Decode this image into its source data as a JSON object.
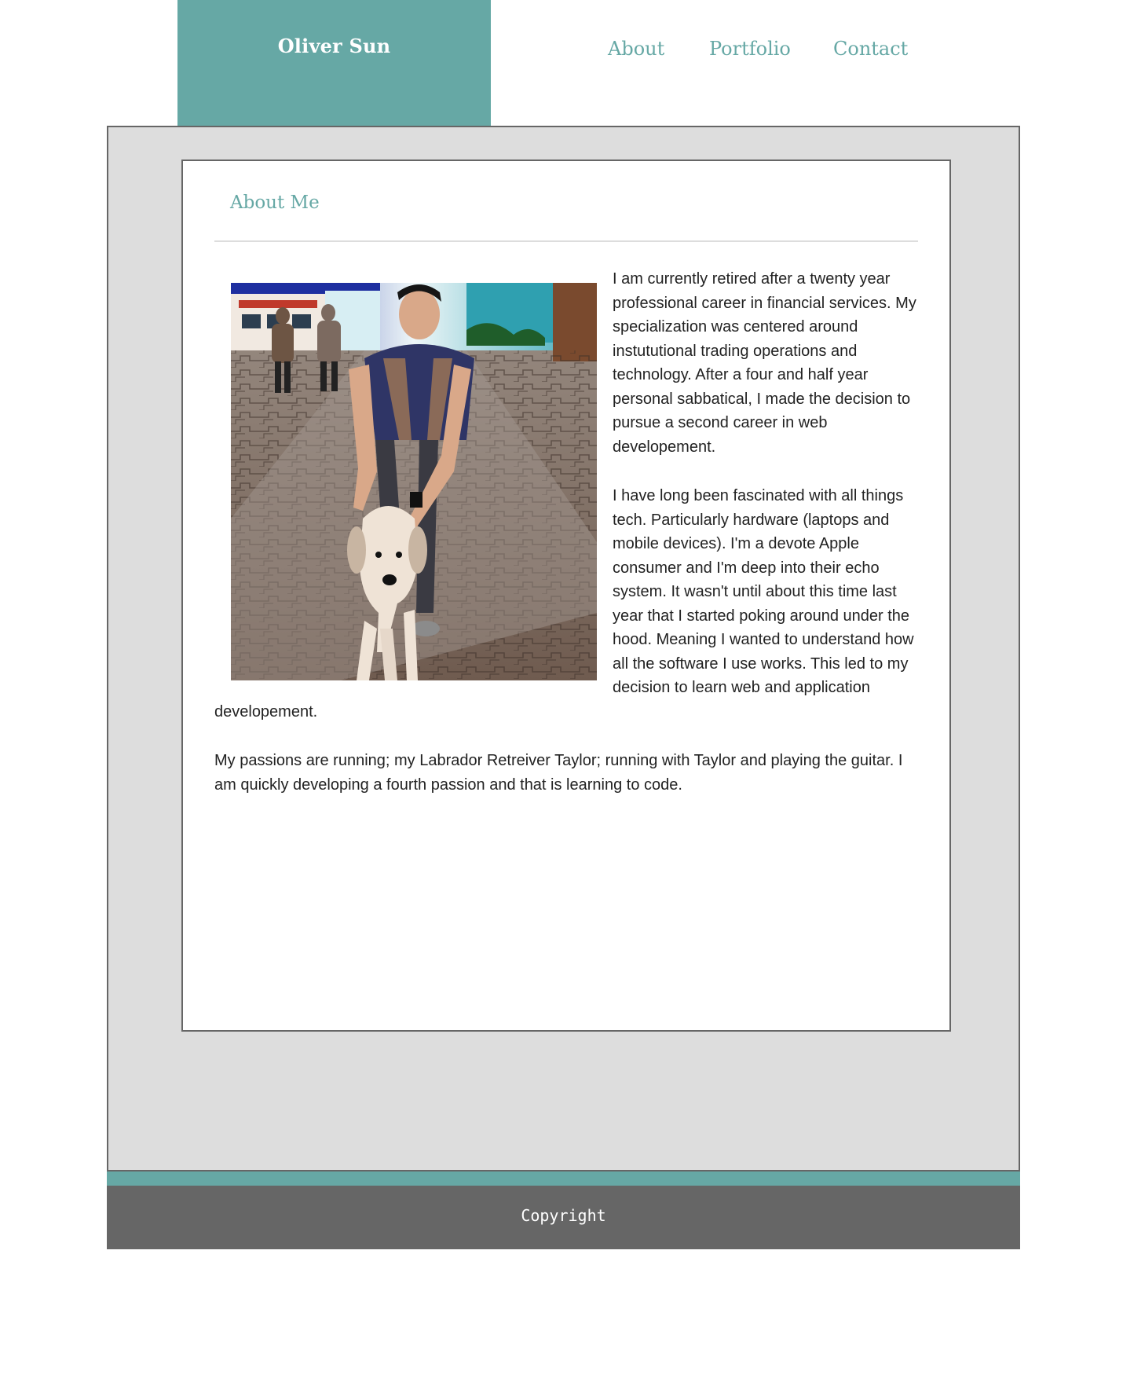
{
  "header": {
    "brand": "Oliver Sun",
    "nav": [
      {
        "label": "About"
      },
      {
        "label": "Portfolio"
      },
      {
        "label": "Contact"
      }
    ]
  },
  "main": {
    "title": "About Me",
    "photo": {
      "alt": "Man crouching with a Labrador Retriever on a brick-paved plaza"
    },
    "paragraphs": [
      "I am currently retired after a twenty year professional career in financial services. My specialization was centered around instututional trading operations and technology. After a four and half year personal sabbatical, I made the decision to pursue a second career in web developement.",
      "I have long been fascinated with all things tech. Particularly hardware (laptops and mobile devices). I'm a devote Apple consumer and I'm deep into their echo system. It wasn't until about this time last year that I started poking around under the hood. Meaning I wanted to understand how all the software I use works. This led to my decision to learn web and application developement.",
      "My passions are running; my Labrador Retreiver Taylor; running with Taylor and playing the guitar. I am quickly developing a fourth passion and that is learning to code."
    ]
  },
  "footer": {
    "text": "Copyright"
  },
  "colors": {
    "accent": "#66a8a5",
    "panel": "#dddddd",
    "border": "#666666",
    "footer": "#666666"
  }
}
